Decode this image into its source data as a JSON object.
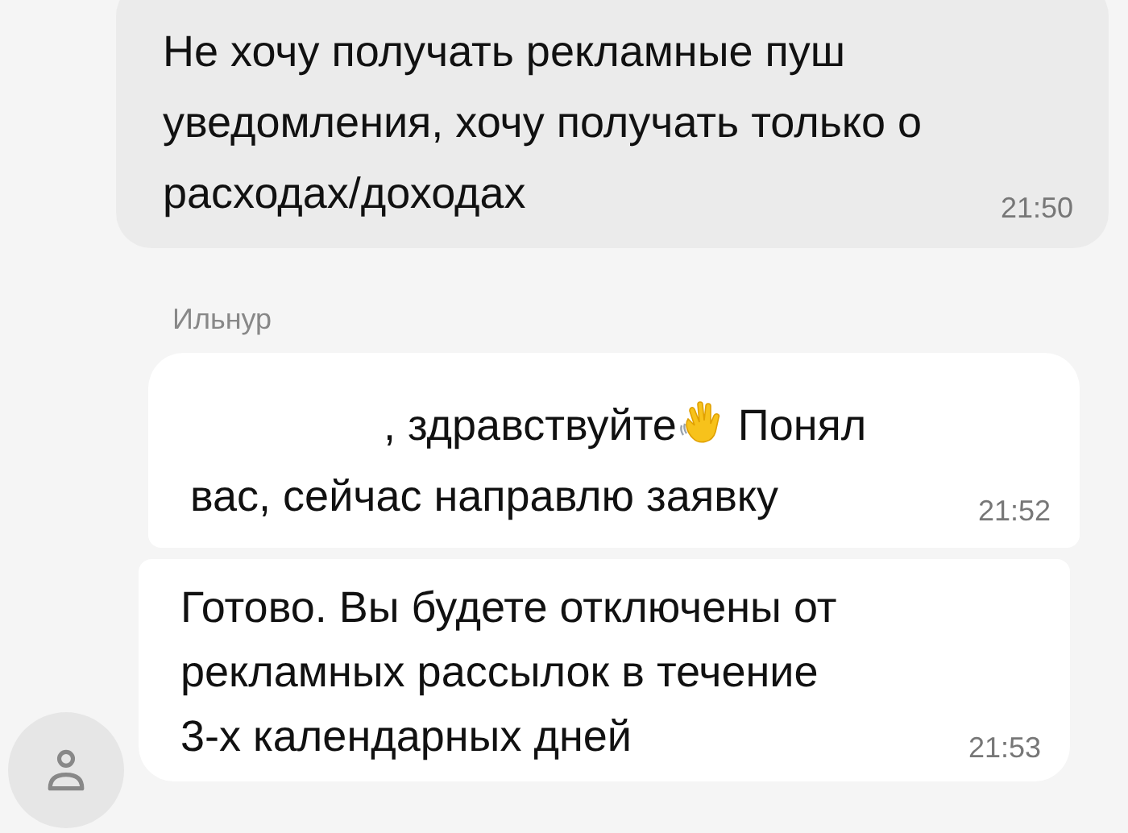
{
  "messages": [
    {
      "kind": "outgoing",
      "text": "Не хочу получать рекламные пуш\nуведомления, хочу получать только о\nрасходах/доходах",
      "time": "21:50"
    },
    {
      "kind": "sender",
      "name": "Ильнур"
    },
    {
      "kind": "incoming_greeting",
      "before": ", здравствуйте",
      "after": "Понял",
      "second_line": "вас, сейчас направлю заявку",
      "time": "21:52"
    },
    {
      "kind": "incoming",
      "text": "Готово. Вы будете отключены от\nрекламных рассылок в течение\n3-х календарных дней",
      "time": "21:53"
    }
  ]
}
